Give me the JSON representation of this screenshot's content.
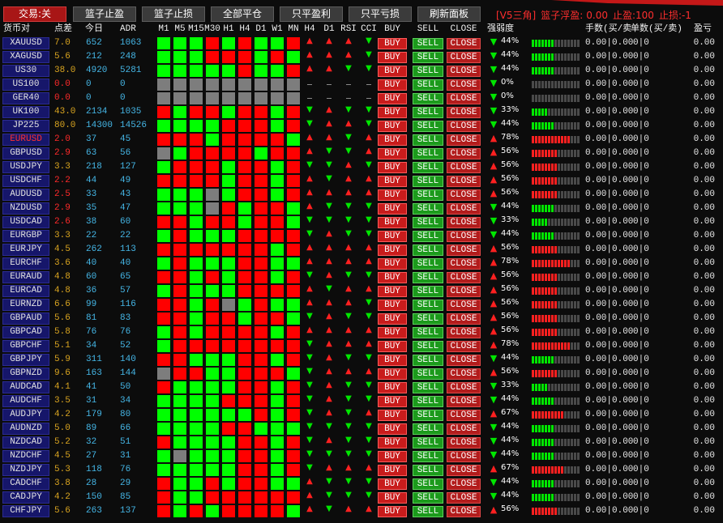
{
  "toolbar": {
    "buttons": [
      "交易:关",
      "篮子止盈",
      "篮子止损",
      "全部平仓",
      "只平盈利",
      "只平亏损",
      "刷新面板"
    ],
    "status": {
      "tag": "[V5三角]",
      "basket_label": "篮子浮盈:",
      "basket_value": "0.00",
      "take_profit": "止盈:100",
      "stop_loss": "止损:-1"
    }
  },
  "header": {
    "pair": "货币对",
    "spread": "点差",
    "today": "今日",
    "adr": "ADR",
    "timeframes": [
      "M1",
      "M5",
      "M15",
      "M30",
      "H1",
      "H4",
      "D1",
      "W1",
      "MN"
    ],
    "signals": [
      "H4",
      "D1",
      "RSI",
      "CCI"
    ],
    "buy": "BUY",
    "sell": "SELL",
    "close": "CLOSE",
    "strength": "强弱度",
    "lots": "手数(买/卖",
    "orders": "单数(买/卖)",
    "profit": "盈亏"
  },
  "row_buttons": {
    "buy": "BUY",
    "sell": "SELL",
    "close": "CLOSE"
  },
  "colors": {
    "green": "#00ff00",
    "red": "#ff0000",
    "gray": "#7d7d7d",
    "up_arrow": "#ff2020",
    "down_arrow": "#00e600",
    "buy_bg": "#c81c1c",
    "buy_border": "#ff5a5a",
    "sell_bg": "#1c9a1c",
    "sell_border": "#5ad25a",
    "close_bg": "#b21c1c",
    "close_border": "#e04848",
    "spread_high": "#daa520",
    "spread_low": "#ff2a2a",
    "volume": "#45b6e6",
    "bar_off": "#4a4a4a"
  },
  "rows": [
    {
      "pair": "XAUUSD",
      "spread": "7.0",
      "today": "652",
      "adr": "1063",
      "tf": [
        "green",
        "green",
        "green",
        "red",
        "green",
        "red",
        "green",
        "green",
        "red"
      ],
      "signals": [
        "up",
        "up",
        "up",
        "down"
      ],
      "strength": {
        "dir": "down",
        "value": "44%"
      },
      "lots": "0.00|0.00",
      "orders": "0|0",
      "profit": "0.00"
    },
    {
      "pair": "XAGUSD",
      "spread": "5.6",
      "today": "212",
      "adr": "248",
      "tf": [
        "green",
        "green",
        "green",
        "red",
        "red",
        "red",
        "green",
        "red",
        "green"
      ],
      "signals": [
        "up",
        "up",
        "up",
        "down"
      ],
      "strength": {
        "dir": "down",
        "value": "44%"
      },
      "lots": "0.00|0.00",
      "orders": "0|0",
      "profit": "0.00"
    },
    {
      "pair": "US30",
      "spread": "38.0",
      "today": "4920",
      "adr": "5281",
      "tf": [
        "green",
        "green",
        "green",
        "green",
        "green",
        "red",
        "green",
        "green",
        "red"
      ],
      "signals": [
        "up",
        "up",
        "down",
        "down"
      ],
      "strength": {
        "dir": "down",
        "value": "44%"
      },
      "lots": "0.00|0.00",
      "orders": "0|0",
      "profit": "0.00"
    },
    {
      "pair": "US100",
      "spread": "0.0",
      "today": "0",
      "adr": "0",
      "tf": [
        "gray",
        "gray",
        "gray",
        "gray",
        "gray",
        "gray",
        "gray",
        "gray",
        "gray"
      ],
      "signals": [
        "none",
        "none",
        "none",
        "none"
      ],
      "strength": {
        "dir": "down",
        "value": "0%"
      },
      "lots": "0.00|0.00",
      "orders": "0|0",
      "profit": "0.00"
    },
    {
      "pair": "GER40",
      "spread": "0.0",
      "today": "0",
      "adr": "0",
      "tf": [
        "gray",
        "gray",
        "gray",
        "gray",
        "gray",
        "gray",
        "gray",
        "gray",
        "gray"
      ],
      "signals": [
        "none",
        "none",
        "none",
        "none"
      ],
      "strength": {
        "dir": "down",
        "value": "0%"
      },
      "lots": "0.00|0.00",
      "orders": "0|0",
      "profit": "0.00"
    },
    {
      "pair": "UK100",
      "spread": "43.0",
      "today": "2134",
      "adr": "1035",
      "tf": [
        "red",
        "green",
        "red",
        "red",
        "green",
        "red",
        "red",
        "green",
        "red"
      ],
      "signals": [
        "down",
        "up",
        "down",
        "down"
      ],
      "strength": {
        "dir": "down",
        "value": "33%"
      },
      "lots": "0.00|0.00",
      "orders": "0|0",
      "profit": "0.00"
    },
    {
      "pair": "JP225",
      "spread": "80.0",
      "today": "14300",
      "adr": "14526",
      "tf": [
        "green",
        "green",
        "green",
        "green",
        "red",
        "red",
        "red",
        "green",
        "red"
      ],
      "signals": [
        "down",
        "up",
        "up",
        "down"
      ],
      "strength": {
        "dir": "down",
        "value": "44%"
      },
      "lots": "0.00|0.00",
      "orders": "0|0",
      "profit": "0.00"
    },
    {
      "pair": "EURUSD",
      "pair_color": "#ff3030",
      "spread": "2.0",
      "today": "37",
      "adr": "45",
      "tf": [
        "red",
        "red",
        "red",
        "green",
        "red",
        "red",
        "red",
        "red",
        "green"
      ],
      "signals": [
        "up",
        "up",
        "down",
        "up"
      ],
      "strength": {
        "dir": "up",
        "value": "78%"
      },
      "lots": "0.00|0.00",
      "orders": "0|0",
      "profit": "0.00"
    },
    {
      "pair": "GBPUSD",
      "spread": "2.9",
      "today": "63",
      "adr": "56",
      "tf": [
        "gray",
        "green",
        "red",
        "red",
        "red",
        "red",
        "green",
        "red",
        "red"
      ],
      "signals": [
        "up",
        "down",
        "down",
        "up"
      ],
      "strength": {
        "dir": "up",
        "value": "56%"
      },
      "lots": "0.00|0.00",
      "orders": "0|0",
      "profit": "0.00"
    },
    {
      "pair": "USDJPY",
      "spread": "3.3",
      "today": "218",
      "adr": "127",
      "tf": [
        "green",
        "red",
        "red",
        "red",
        "green",
        "red",
        "red",
        "green",
        "red"
      ],
      "signals": [
        "down",
        "down",
        "up",
        "down"
      ],
      "strength": {
        "dir": "up",
        "value": "56%"
      },
      "lots": "0.00|0.00",
      "orders": "0|0",
      "profit": "0.00"
    },
    {
      "pair": "USDCHF",
      "spread": "2.2",
      "today": "44",
      "adr": "49",
      "tf": [
        "red",
        "red",
        "red",
        "red",
        "green",
        "red",
        "red",
        "green",
        "red"
      ],
      "signals": [
        "up",
        "down",
        "up",
        "up"
      ],
      "strength": {
        "dir": "up",
        "value": "56%"
      },
      "lots": "0.00|0.00",
      "orders": "0|0",
      "profit": "0.00"
    },
    {
      "pair": "AUDUSD",
      "spread": "2.5",
      "today": "33",
      "adr": "43",
      "tf": [
        "green",
        "green",
        "green",
        "gray",
        "green",
        "red",
        "red",
        "green",
        "red"
      ],
      "signals": [
        "up",
        "up",
        "up",
        "up"
      ],
      "strength": {
        "dir": "up",
        "value": "56%"
      },
      "lots": "0.00|0.00",
      "orders": "0|0",
      "profit": "0.00"
    },
    {
      "pair": "NZDUSD",
      "spread": "2.9",
      "today": "35",
      "adr": "47",
      "tf": [
        "green",
        "green",
        "green",
        "gray",
        "red",
        "green",
        "red",
        "red",
        "green"
      ],
      "signals": [
        "up",
        "down",
        "down",
        "down"
      ],
      "strength": {
        "dir": "down",
        "value": "44%"
      },
      "lots": "0.00|0.00",
      "orders": "0|0",
      "profit": "0.00"
    },
    {
      "pair": "USDCAD",
      "spread": "2.6",
      "today": "38",
      "adr": "60",
      "tf": [
        "red",
        "red",
        "green",
        "red",
        "red",
        "green",
        "red",
        "red",
        "green"
      ],
      "signals": [
        "down",
        "down",
        "down",
        "down"
      ],
      "strength": {
        "dir": "down",
        "value": "33%"
      },
      "lots": "0.00|0.00",
      "orders": "0|0",
      "profit": "0.00"
    },
    {
      "pair": "EURGBP",
      "spread": "3.3",
      "today": "22",
      "adr": "22",
      "tf": [
        "green",
        "red",
        "green",
        "green",
        "green",
        "red",
        "red",
        "red",
        "red"
      ],
      "signals": [
        "down",
        "up",
        "down",
        "down"
      ],
      "strength": {
        "dir": "down",
        "value": "44%"
      },
      "lots": "0.00|0.00",
      "orders": "0|0",
      "profit": "0.00"
    },
    {
      "pair": "EURJPY",
      "spread": "4.5",
      "today": "262",
      "adr": "113",
      "tf": [
        "red",
        "red",
        "red",
        "red",
        "red",
        "red",
        "red",
        "green",
        "red"
      ],
      "signals": [
        "up",
        "up",
        "up",
        "up"
      ],
      "strength": {
        "dir": "up",
        "value": "56%"
      },
      "lots": "0.00|0.00",
      "orders": "0|0",
      "profit": "0.00"
    },
    {
      "pair": "EURCHF",
      "spread": "3.6",
      "today": "40",
      "adr": "40",
      "tf": [
        "green",
        "red",
        "green",
        "green",
        "green",
        "red",
        "red",
        "green",
        "green"
      ],
      "signals": [
        "up",
        "up",
        "up",
        "up"
      ],
      "strength": {
        "dir": "up",
        "value": "78%"
      },
      "lots": "0.00|0.00",
      "orders": "0|0",
      "profit": "0.00"
    },
    {
      "pair": "EURAUD",
      "spread": "4.8",
      "today": "60",
      "adr": "65",
      "tf": [
        "red",
        "red",
        "green",
        "red",
        "green",
        "red",
        "red",
        "green",
        "red"
      ],
      "signals": [
        "down",
        "up",
        "down",
        "down"
      ],
      "strength": {
        "dir": "up",
        "value": "56%"
      },
      "lots": "0.00|0.00",
      "orders": "0|0",
      "profit": "0.00"
    },
    {
      "pair": "EURCAD",
      "spread": "4.8",
      "today": "36",
      "adr": "57",
      "tf": [
        "green",
        "red",
        "green",
        "green",
        "green",
        "red",
        "red",
        "red",
        "red"
      ],
      "signals": [
        "up",
        "down",
        "up",
        "up"
      ],
      "strength": {
        "dir": "up",
        "value": "56%"
      },
      "lots": "0.00|0.00",
      "orders": "0|0",
      "profit": "0.00"
    },
    {
      "pair": "EURNZD",
      "spread": "6.6",
      "today": "99",
      "adr": "116",
      "tf": [
        "red",
        "red",
        "green",
        "red",
        "gray",
        "green",
        "red",
        "green",
        "green"
      ],
      "signals": [
        "up",
        "up",
        "up",
        "down"
      ],
      "strength": {
        "dir": "up",
        "value": "56%"
      },
      "lots": "0.00|0.00",
      "orders": "0|0",
      "profit": "0.00"
    },
    {
      "pair": "GBPAUD",
      "spread": "5.6",
      "today": "81",
      "adr": "83",
      "tf": [
        "red",
        "red",
        "green",
        "red",
        "red",
        "green",
        "red",
        "red",
        "green"
      ],
      "signals": [
        "down",
        "up",
        "down",
        "down"
      ],
      "strength": {
        "dir": "up",
        "value": "56%"
      },
      "lots": "0.00|0.00",
      "orders": "0|0",
      "profit": "0.00"
    },
    {
      "pair": "GBPCAD",
      "spread": "5.8",
      "today": "76",
      "adr": "76",
      "tf": [
        "green",
        "red",
        "green",
        "red",
        "red",
        "red",
        "red",
        "green",
        "red"
      ],
      "signals": [
        "up",
        "up",
        "up",
        "up"
      ],
      "strength": {
        "dir": "up",
        "value": "56%"
      },
      "lots": "0.00|0.00",
      "orders": "0|0",
      "profit": "0.00"
    },
    {
      "pair": "GBPCHF",
      "spread": "5.1",
      "today": "34",
      "adr": "52",
      "tf": [
        "green",
        "red",
        "red",
        "red",
        "red",
        "red",
        "red",
        "red",
        "red"
      ],
      "signals": [
        "down",
        "up",
        "up",
        "up"
      ],
      "strength": {
        "dir": "up",
        "value": "78%"
      },
      "lots": "0.00|0.00",
      "orders": "0|0",
      "profit": "0.00"
    },
    {
      "pair": "GBPJPY",
      "spread": "5.9",
      "today": "311",
      "adr": "140",
      "tf": [
        "red",
        "red",
        "green",
        "green",
        "green",
        "red",
        "red",
        "green",
        "red"
      ],
      "signals": [
        "down",
        "up",
        "down",
        "down"
      ],
      "strength": {
        "dir": "down",
        "value": "44%"
      },
      "lots": "0.00|0.00",
      "orders": "0|0",
      "profit": "0.00"
    },
    {
      "pair": "GBPNZD",
      "spread": "9.6",
      "today": "163",
      "adr": "144",
      "tf": [
        "gray",
        "red",
        "red",
        "green",
        "green",
        "red",
        "red",
        "red",
        "green"
      ],
      "signals": [
        "down",
        "up",
        "up",
        "up"
      ],
      "strength": {
        "dir": "up",
        "value": "56%"
      },
      "lots": "0.00|0.00",
      "orders": "0|0",
      "profit": "0.00"
    },
    {
      "pair": "AUDCAD",
      "spread": "4.1",
      "today": "41",
      "adr": "50",
      "tf": [
        "red",
        "green",
        "green",
        "green",
        "green",
        "red",
        "red",
        "green",
        "red"
      ],
      "signals": [
        "down",
        "up",
        "down",
        "down"
      ],
      "strength": {
        "dir": "down",
        "value": "33%"
      },
      "lots": "0.00|0.00",
      "orders": "0|0",
      "profit": "0.00"
    },
    {
      "pair": "AUDCHF",
      "spread": "3.5",
      "today": "31",
      "adr": "34",
      "tf": [
        "green",
        "green",
        "green",
        "green",
        "red",
        "red",
        "red",
        "green",
        "red"
      ],
      "signals": [
        "down",
        "up",
        "down",
        "down"
      ],
      "strength": {
        "dir": "down",
        "value": "44%"
      },
      "lots": "0.00|0.00",
      "orders": "0|0",
      "profit": "0.00"
    },
    {
      "pair": "AUDJPY",
      "spread": "4.2",
      "today": "179",
      "adr": "80",
      "tf": [
        "green",
        "green",
        "green",
        "green",
        "green",
        "green",
        "red",
        "green",
        "red"
      ],
      "signals": [
        "down",
        "up",
        "down",
        "up"
      ],
      "strength": {
        "dir": "up",
        "value": "67%"
      },
      "lots": "0.00|0.00",
      "orders": "0|0",
      "profit": "0.00"
    },
    {
      "pair": "AUDNZD",
      "spread": "5.0",
      "today": "89",
      "adr": "66",
      "tf": [
        "green",
        "green",
        "green",
        "green",
        "red",
        "red",
        "green",
        "green",
        "green"
      ],
      "signals": [
        "down",
        "down",
        "down",
        "down"
      ],
      "strength": {
        "dir": "down",
        "value": "44%"
      },
      "lots": "0.00|0.00",
      "orders": "0|0",
      "profit": "0.00"
    },
    {
      "pair": "NZDCAD",
      "spread": "5.2",
      "today": "32",
      "adr": "51",
      "tf": [
        "red",
        "green",
        "green",
        "green",
        "green",
        "red",
        "red",
        "green",
        "red"
      ],
      "signals": [
        "down",
        "up",
        "down",
        "down"
      ],
      "strength": {
        "dir": "down",
        "value": "44%"
      },
      "lots": "0.00|0.00",
      "orders": "0|0",
      "profit": "0.00"
    },
    {
      "pair": "NZDCHF",
      "spread": "4.5",
      "today": "27",
      "adr": "31",
      "tf": [
        "green",
        "gray",
        "green",
        "green",
        "green",
        "red",
        "red",
        "green",
        "red"
      ],
      "signals": [
        "down",
        "down",
        "down",
        "down"
      ],
      "strength": {
        "dir": "down",
        "value": "44%"
      },
      "lots": "0.00|0.00",
      "orders": "0|0",
      "profit": "0.00"
    },
    {
      "pair": "NZDJPY",
      "spread": "5.3",
      "today": "118",
      "adr": "76",
      "tf": [
        "green",
        "green",
        "green",
        "green",
        "green",
        "red",
        "red",
        "green",
        "red"
      ],
      "signals": [
        "down",
        "up",
        "up",
        "up"
      ],
      "strength": {
        "dir": "up",
        "value": "67%"
      },
      "lots": "0.00|0.00",
      "orders": "0|0",
      "profit": "0.00"
    },
    {
      "pair": "CADCHF",
      "spread": "3.8",
      "today": "28",
      "adr": "29",
      "tf": [
        "red",
        "green",
        "green",
        "red",
        "green",
        "red",
        "red",
        "green",
        "green"
      ],
      "signals": [
        "up",
        "down",
        "down",
        "down"
      ],
      "strength": {
        "dir": "down",
        "value": "44%"
      },
      "lots": "0.00|0.00",
      "orders": "0|0",
      "profit": "0.00"
    },
    {
      "pair": "CADJPY",
      "spread": "4.2",
      "today": "150",
      "adr": "85",
      "tf": [
        "red",
        "green",
        "green",
        "red",
        "red",
        "red",
        "red",
        "red",
        "red"
      ],
      "signals": [
        "up",
        "down",
        "down",
        "down"
      ],
      "strength": {
        "dir": "down",
        "value": "44%"
      },
      "lots": "0.00|0.00",
      "orders": "0|0",
      "profit": "0.00"
    },
    {
      "pair": "CHFJPY",
      "spread": "5.6",
      "today": "263",
      "adr": "137",
      "tf": [
        "red",
        "green",
        "red",
        "green",
        "red",
        "red",
        "red",
        "red",
        "green"
      ],
      "signals": [
        "up",
        "down",
        "up",
        "up"
      ],
      "strength": {
        "dir": "up",
        "value": "56%"
      },
      "lots": "0.00|0.00",
      "orders": "0|0",
      "profit": "0.00"
    }
  ]
}
